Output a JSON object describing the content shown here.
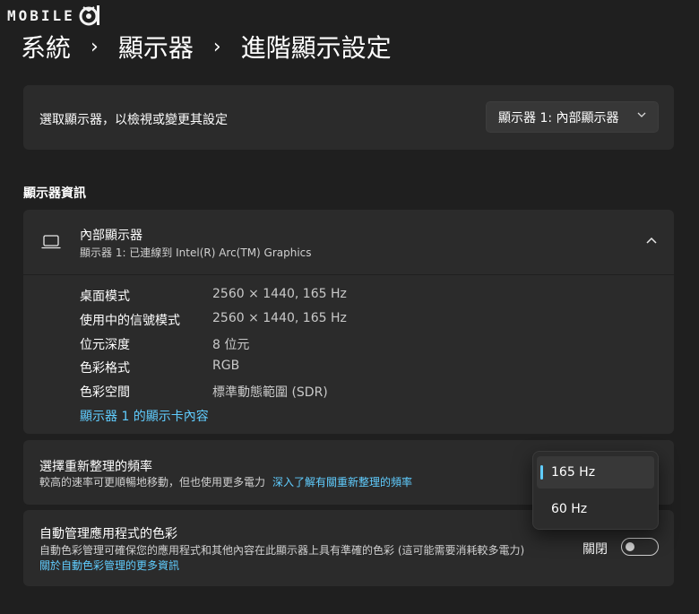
{
  "watermark": {
    "text": "MOBILE"
  },
  "breadcrumb": {
    "items": [
      "系統",
      "顯示器",
      "進階顯示設定"
    ],
    "separator": "›"
  },
  "display_select": {
    "label": "選取顯示器，以檢視或變更其設定",
    "selected": "顯示器 1: 內部顯示器"
  },
  "section": {
    "title": "顯示器資訊"
  },
  "display_info": {
    "title": "內部顯示器",
    "subtitle": "顯示器 1: 已連線到 Intel(R) Arc(TM) Graphics",
    "rows": [
      {
        "label": "桌面模式",
        "value": "2560 × 1440, 165 Hz"
      },
      {
        "label": "使用中的信號模式",
        "value": "2560 × 1440, 165 Hz"
      },
      {
        "label": "位元深度",
        "value": "8 位元"
      },
      {
        "label": "色彩格式",
        "value": "RGB"
      },
      {
        "label": "色彩空間",
        "value": "標準動態範圍 (SDR)"
      }
    ],
    "adapter_link": "顯示器 1 的顯示卡內容"
  },
  "refresh_rate": {
    "title": "選擇重新整理的頻率",
    "description": "較高的速率可更順暢地移動，但也使用更多電力",
    "link": "深入了解有關重新整理的頻率",
    "options": [
      "165 Hz",
      "60 Hz"
    ],
    "selected": "165 Hz"
  },
  "auto_color": {
    "title": "自動管理應用程式的色彩",
    "description": "自動色彩管理可確保您的應用程式和其他內容在此顯示器上具有準確的色彩 (這可能需要消耗較多電力)",
    "link": "關於自動色彩管理的更多資訊",
    "toggle_label": "關閉",
    "toggle_on": false
  },
  "colors": {
    "accent": "#60cdff",
    "background": "#1f1f1f",
    "card": "#2b2b2b"
  }
}
